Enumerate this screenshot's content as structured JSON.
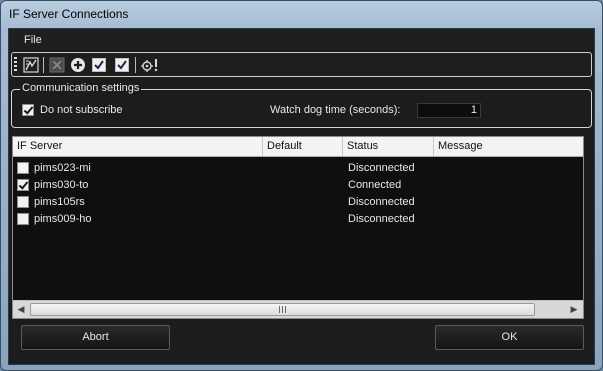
{
  "window": {
    "title": "IF Server Connections"
  },
  "menu": {
    "items": [
      {
        "label": "File"
      }
    ]
  },
  "toolbar": {
    "buttons": [
      {
        "icon": "connect-all-icon"
      },
      {
        "icon": "disconnect-icon"
      },
      {
        "icon": "add-server-icon"
      },
      {
        "icon": "check-icon"
      },
      {
        "icon": "check-all-icon"
      },
      {
        "icon": "settings-alert-icon"
      }
    ]
  },
  "communication": {
    "legend": "Communication settings",
    "do_not_subscribe": {
      "label": "Do not subscribe",
      "checked": true
    },
    "watchdog": {
      "label": "Watch dog time (seconds):",
      "value": "1"
    }
  },
  "grid": {
    "columns": [
      "IF Server",
      "Default",
      "Status",
      "Message"
    ],
    "rows": [
      {
        "checked": false,
        "server": "pims023-mi",
        "default": "",
        "status": "Disconnected",
        "message": ""
      },
      {
        "checked": true,
        "server": "pims030-to",
        "default": "",
        "status": "Connected",
        "message": ""
      },
      {
        "checked": false,
        "server": "pims105rs",
        "default": "",
        "status": "Disconnected",
        "message": ""
      },
      {
        "checked": false,
        "server": "pims009-ho",
        "default": "",
        "status": "Disconnected",
        "message": ""
      }
    ]
  },
  "buttons": {
    "abort": "Abort",
    "ok": "OK"
  }
}
